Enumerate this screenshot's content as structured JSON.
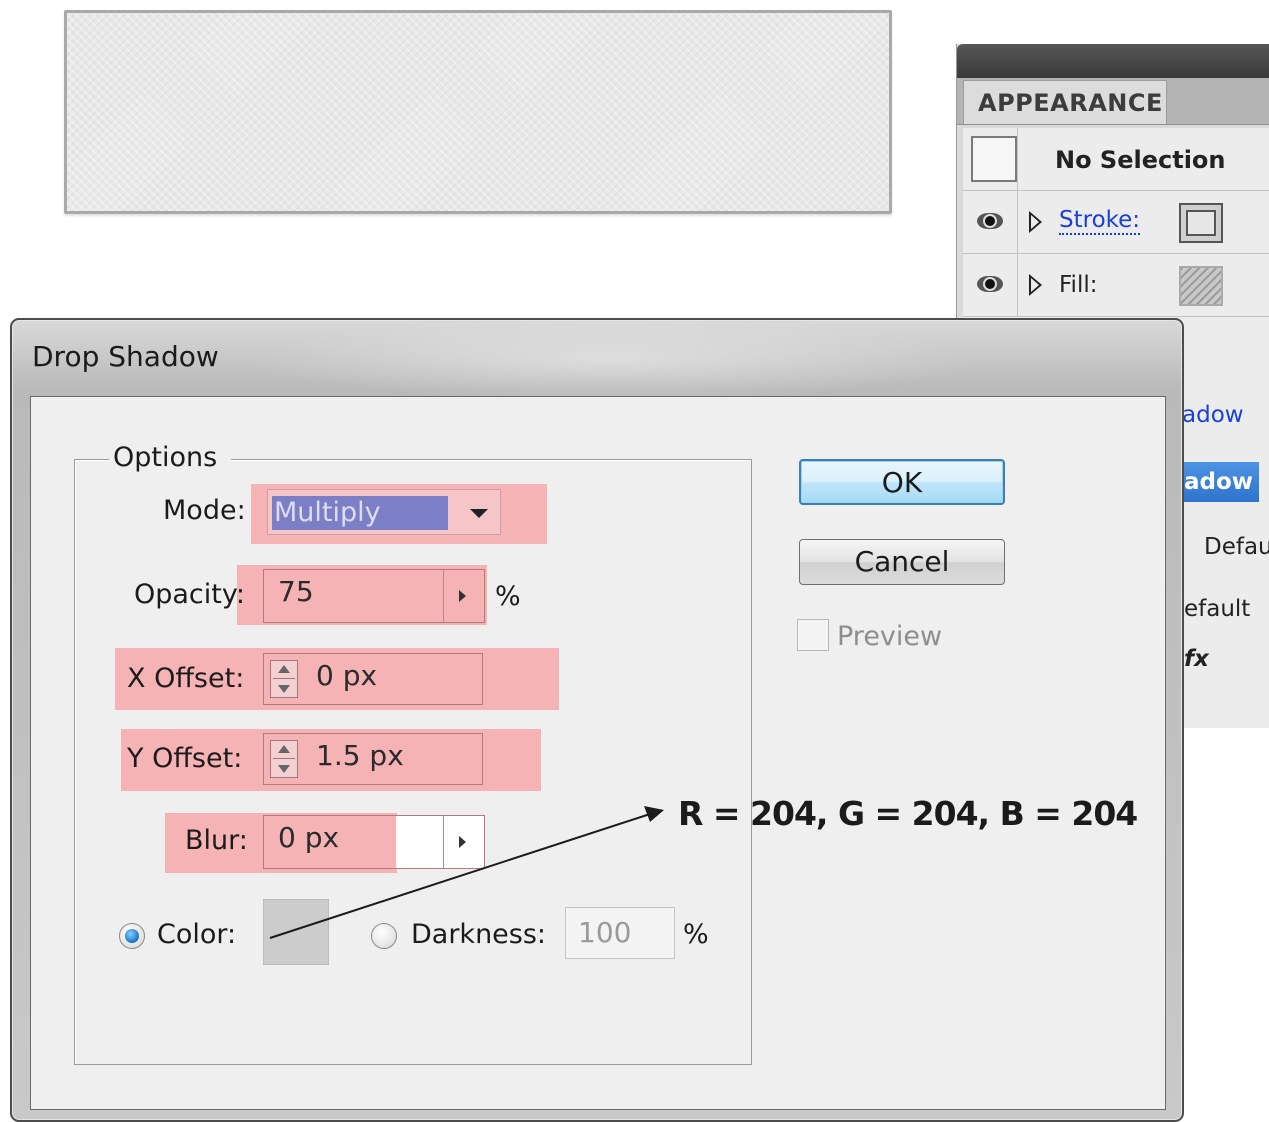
{
  "appearance_panel": {
    "tab_title": "APPEARANCE",
    "selection_label": "No Selection",
    "stroke_label": "Stroke:",
    "fill_label": "Fill:",
    "fragment_shadow_link": "adow",
    "fragment_shadow_selected": "adow",
    "fragment_default_1": "Defau",
    "fragment_default_2": "efault",
    "fragment_fx": "fx"
  },
  "dialog": {
    "title": "Drop Shadow",
    "options_legend": "Options",
    "mode": {
      "label": "Mode:",
      "value": "Multiply"
    },
    "opacity": {
      "label": "Opacity:",
      "value": "75",
      "unit": "%"
    },
    "x_offset": {
      "label": "X Offset:",
      "value": "0 px"
    },
    "y_offset": {
      "label": "Y Offset:",
      "value": "1.5 px"
    },
    "blur": {
      "label": "Blur:",
      "value": "0 px"
    },
    "color_option": {
      "label": "Color:",
      "selected": true,
      "swatch": "#cccccc"
    },
    "darkness_option": {
      "label": "Darkness:",
      "selected": false,
      "value": "100",
      "unit": "%"
    },
    "buttons": {
      "ok": "OK",
      "cancel": "Cancel"
    },
    "preview": {
      "label": "Preview",
      "checked": false
    }
  },
  "annotation": {
    "text": "R = 204, G = 204, B = 204"
  },
  "colors": {
    "highlight": "#f6b3b6",
    "link": "#1a3fd8",
    "selected_mode": "#7c7fc6"
  }
}
